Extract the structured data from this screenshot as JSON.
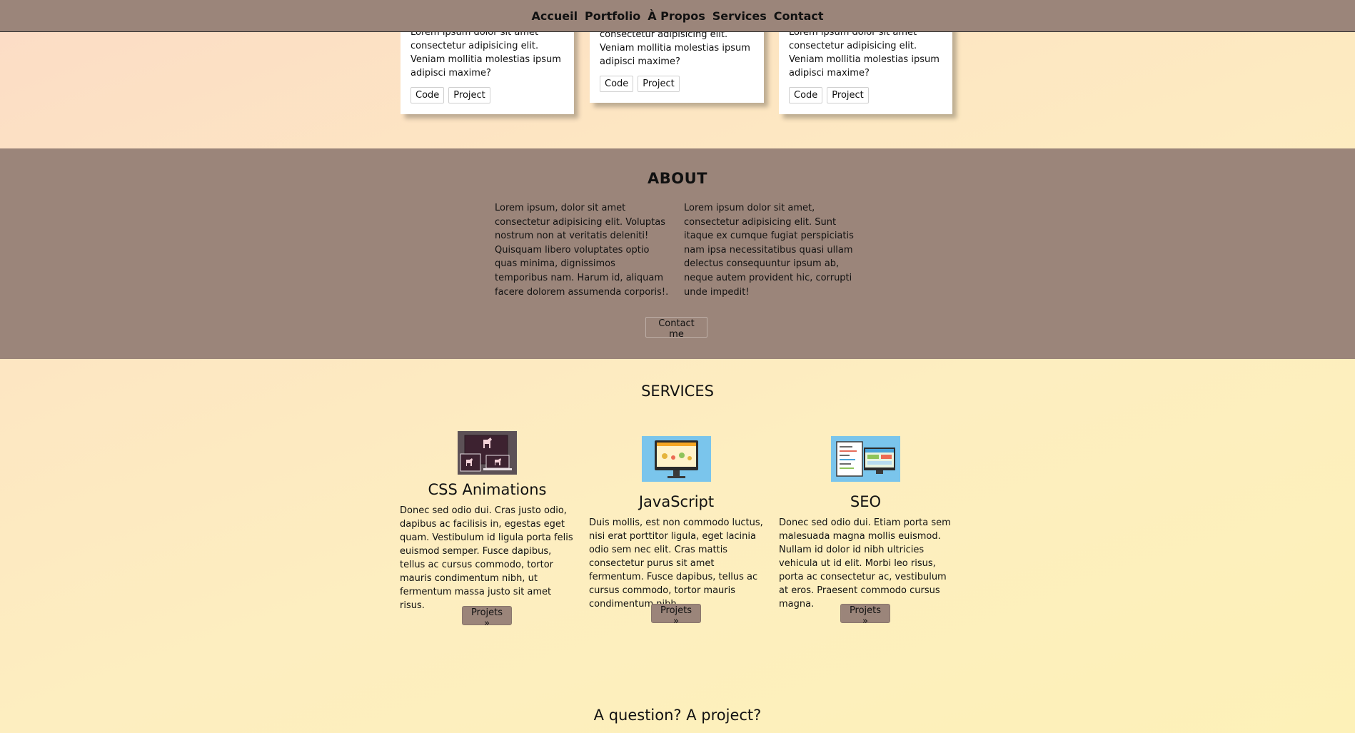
{
  "nav": {
    "items": [
      {
        "label": "Accueil"
      },
      {
        "label": "Portfolio"
      },
      {
        "label": "À Propos"
      },
      {
        "label": "Services"
      },
      {
        "label": "Contact"
      }
    ]
  },
  "portfolio": {
    "cards": [
      {
        "text": "Lorem ipsum dolor sit amet consectetur adipisicing elit. Veniam mollitia molestias ipsum adipisci maxime?",
        "code_label": "Code",
        "project_label": "Project"
      },
      {
        "text": "consectetur adipisicing elit. Veniam mollitia molestias ipsum adipisci maxime?",
        "code_label": "Code",
        "project_label": "Project"
      },
      {
        "text": "Lorem ipsum dolor sit amet consectetur adipisicing elit. Veniam mollitia molestias ipsum adipisci maxime?",
        "code_label": "Code",
        "project_label": "Project"
      }
    ]
  },
  "about": {
    "title": "ABOUT",
    "col1": "Lorem ipsum, dolor sit amet consectetur adipisicing elit. Voluptas nostrum non at veritatis deleniti! Quisquam libero voluptates optio quas minima, dignissimos temporibus nam. Harum id, aliquam facere dolorem assumenda corporis!.",
    "col2": "Lorem ipsum dolor sit amet, consectetur adipisicing elit. Sunt itaque ex cumque fugiat perspiciatis nam ipsa necessitatibus quasi ullam delectus consequuntur ipsum ab, neque autem provident hic, corrupti unde impedit!",
    "contact_label": "Contact me"
  },
  "services": {
    "title": "SERVICES",
    "items": [
      {
        "title": "CSS Animations",
        "text": "Donec sed odio dui. Cras justo odio, dapibus ac facilisis in, egestas eget quam. Vestibulum id ligula porta felis euismod semper. Fusce dapibus, tellus ac cursus commodo, tortor mauris condimentum nibh, ut fermentum massa justo sit amet risus.",
        "button": "Projets »",
        "icon": "animation-devices-icon"
      },
      {
        "title": "JavaScript",
        "text": "Duis mollis, est non commodo luctus, nisi erat porttitor ligula, eget lacinia odio sem nec elit. Cras mattis consectetur purus sit amet fermentum. Fusce dapibus, tellus ac cursus commodo, tortor mauris condimentum nibh.",
        "button": "Projets »",
        "icon": "monitor-dashboard-icon"
      },
      {
        "title": "SEO",
        "text": "Donec sed odio dui. Etiam porta sem malesuada magna mollis euismod. Nullam id dolor id nibh ultricies vehicula ut id elit. Morbi leo risus, porta ac consectetur ac, vestibulum at eros. Praesent commodo cursus magna.",
        "button": "Projets »",
        "icon": "code-screens-icon"
      }
    ]
  },
  "contact_section": {
    "title": "A question? A project?"
  }
}
